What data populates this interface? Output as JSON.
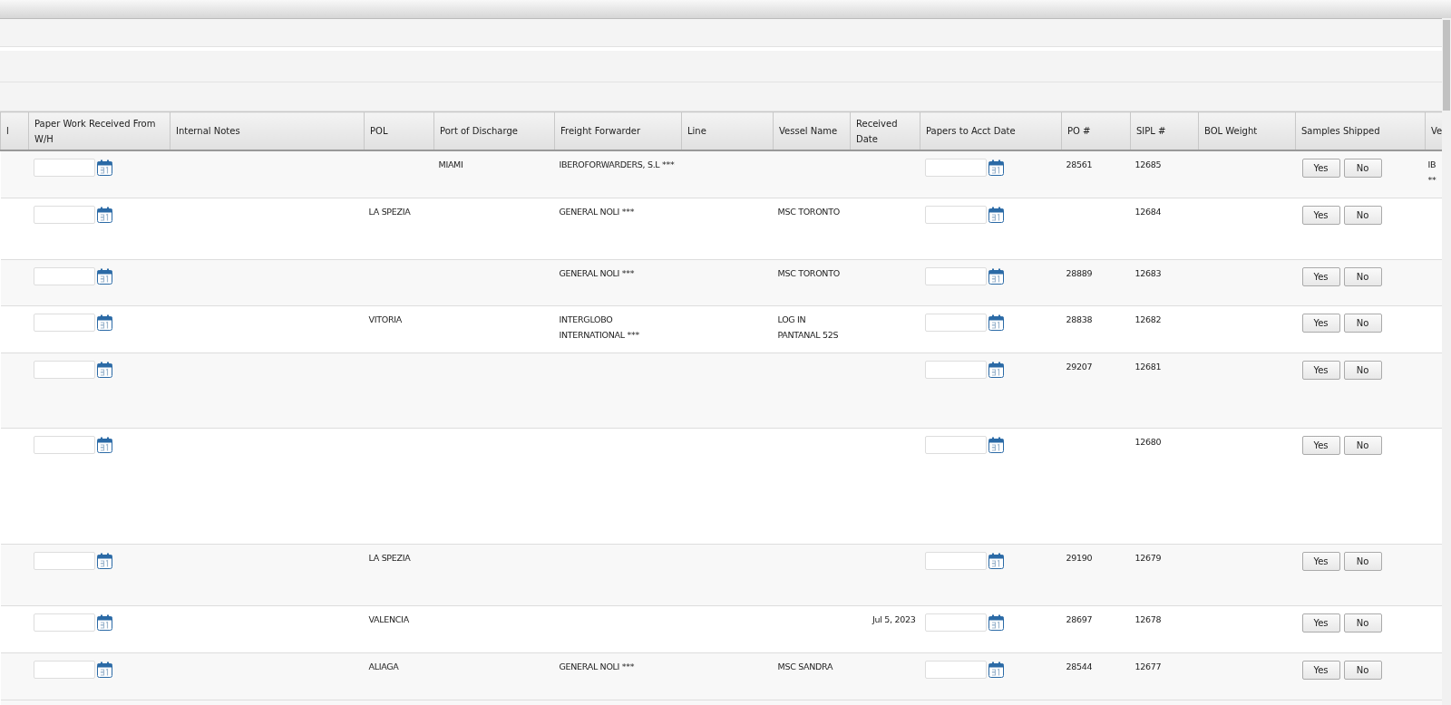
{
  "table": {
    "columns": [
      {
        "label": "l"
      },
      {
        "label": "Paper Work Received From W/H"
      },
      {
        "label": "Internal Notes"
      },
      {
        "label": "POL"
      },
      {
        "label": "Port of Discharge"
      },
      {
        "label": "Freight Forwarder"
      },
      {
        "label": "Line"
      },
      {
        "label": "Vessel Name"
      },
      {
        "label": "Received Date"
      },
      {
        "label": "Papers to Acct Date"
      },
      {
        "label": "PO #"
      },
      {
        "label": "SIPL #"
      },
      {
        "label": "BOL Weight"
      },
      {
        "label": "Samples Shipped"
      },
      {
        "label": "Ve"
      }
    ],
    "rows": [
      {
        "pol": "",
        "port_of_discharge": "MIAMI",
        "freight_forwarder": "IBEROFORWARDERS, S.L ***",
        "vessel_name": "",
        "received_date": "",
        "po": "28561",
        "sipl": "12685",
        "sample_buttons": [
          "Yes",
          "No"
        ],
        "column_15": "IB **"
      },
      {
        "pol": "LA SPEZIA",
        "port_of_discharge": "",
        "freight_forwarder": "GENERAL NOLI ***",
        "vessel_name": "MSC TORONTO",
        "received_date": "",
        "po": "",
        "sipl": "12684",
        "sample_buttons": [
          "Yes",
          "No"
        ],
        "column_15": ""
      },
      {
        "pol": "",
        "port_of_discharge": "",
        "freight_forwarder": "GENERAL NOLI ***",
        "vessel_name": "MSC TORONTO",
        "received_date": "",
        "po": "28889",
        "sipl": "12683",
        "sample_buttons": [
          "Yes",
          "No"
        ],
        "column_15": ""
      },
      {
        "pol": "VITORIA",
        "port_of_discharge": "",
        "freight_forwarder": "INTERGLOBO INTERNATIONAL ***",
        "vessel_name": "LOG IN PANTANAL 52S",
        "received_date": "",
        "po": "28838",
        "sipl": "12682",
        "sample_buttons": [
          "Yes",
          "No"
        ],
        "column_15": ""
      },
      {
        "pol": "",
        "port_of_discharge": "",
        "freight_forwarder": "",
        "vessel_name": "",
        "received_date": "",
        "po": "29207",
        "sipl": "12681",
        "sample_buttons": [
          "Yes",
          "No"
        ],
        "column_15": ""
      },
      {
        "pol": "",
        "port_of_discharge": "",
        "freight_forwarder": "",
        "vessel_name": "",
        "received_date": "",
        "po": "",
        "sipl": "12680",
        "sample_buttons": [
          "Yes",
          "No"
        ],
        "column_15": ""
      },
      {
        "pol": "LA SPEZIA",
        "port_of_discharge": "",
        "freight_forwarder": "",
        "vessel_name": "",
        "received_date": "",
        "po": "29190",
        "sipl": "12679",
        "sample_buttons": [
          "Yes",
          "No"
        ],
        "column_15": ""
      },
      {
        "pol": "VALENCIA",
        "port_of_discharge": "",
        "freight_forwarder": "",
        "vessel_name": "",
        "received_date": "Jul 5, 2023",
        "po": "28697",
        "sipl": "12678",
        "sample_buttons": [
          "Yes",
          "No"
        ],
        "column_15": ""
      },
      {
        "pol": "ALIAGA",
        "port_of_discharge": "",
        "freight_forwarder": "GENERAL NOLI ***",
        "vessel_name": "MSC SANDRA",
        "received_date": "",
        "po": "28544",
        "sipl": "12677",
        "sample_buttons": [
          "Yes",
          "No"
        ],
        "column_15": ""
      }
    ]
  }
}
